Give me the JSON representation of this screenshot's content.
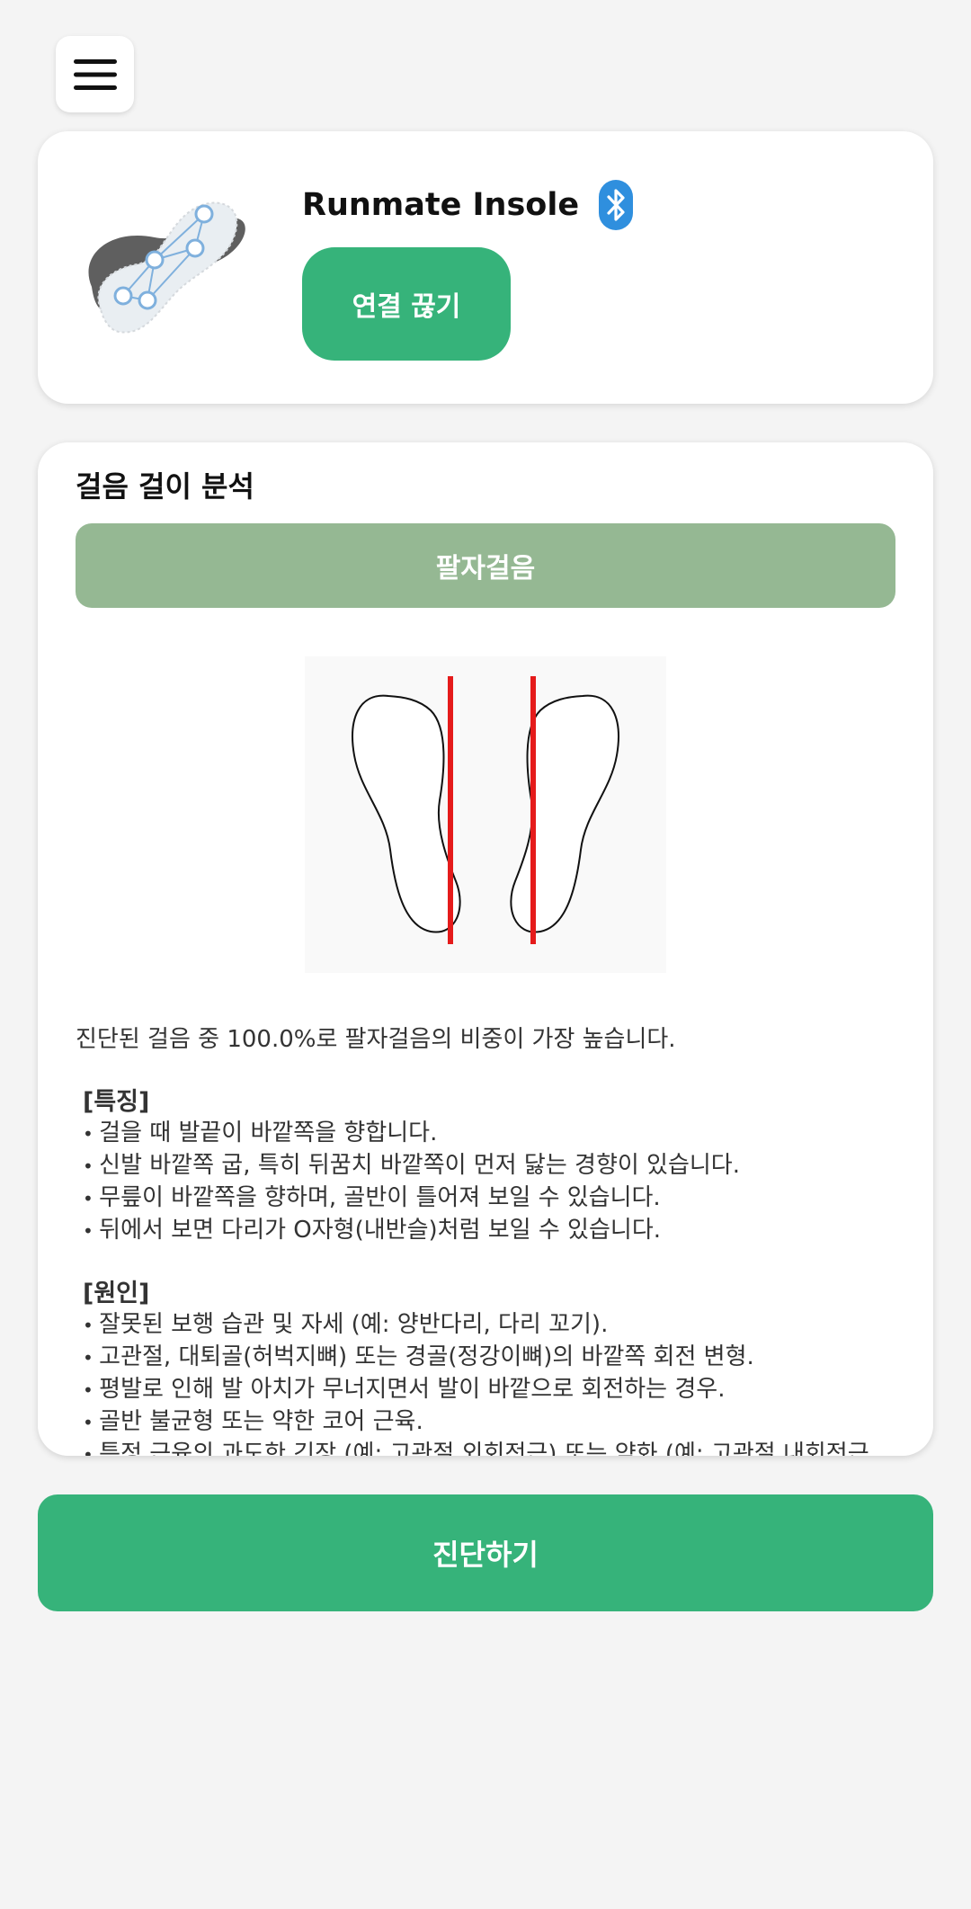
{
  "icons": {
    "menu": "hamburger-menu-icon",
    "bluetooth": "bluetooth-icon",
    "insole": "smart-insole-image"
  },
  "device": {
    "name": "Runmate Insole",
    "disconnect_label": "연결 끊기"
  },
  "analysis": {
    "title": "걸음 걸이 분석",
    "result": "팔자걸음",
    "summary": "진단된 걸음 중 100.0%로 팔자걸음의 비중이 가장 높습니다.",
    "features_heading": "[특징]",
    "features": [
      "걸을 때 발끝이 바깥쪽을 향합니다.",
      "신발 바깥쪽 굽, 특히 뒤꿈치 바깥쪽이 먼저 닳는 경향이 있습니다.",
      "무릎이 바깥쪽을 향하며, 골반이 틀어져 보일 수 있습니다.",
      "뒤에서 보면 다리가 O자형(내반슬)처럼 보일 수 있습니다."
    ],
    "causes_heading": "[원인]",
    "causes": [
      "잘못된 보행 습관 및 자세 (예: 양반다리, 다리 꼬기).",
      "고관절, 대퇴골(허벅지뼈) 또는 경골(정강이뼈)의 바깥쪽 회전 변형.",
      "평발로 인해 발 아치가 무너지면서 발이 바깥으로 회전하는 경우.",
      "골반 불균형 또는 약한 코어 근육.",
      "특정 근육의 과도한 긴장 (예: 고관절 외회전근) 또는 약화 (예: 고관절 내회전근"
    ]
  },
  "diagnose_label": "진단하기",
  "colors": {
    "accent": "#36b37a",
    "result_banner": "#95b893",
    "guide_line": "#e51b1b",
    "background": "#f4f4f4"
  }
}
